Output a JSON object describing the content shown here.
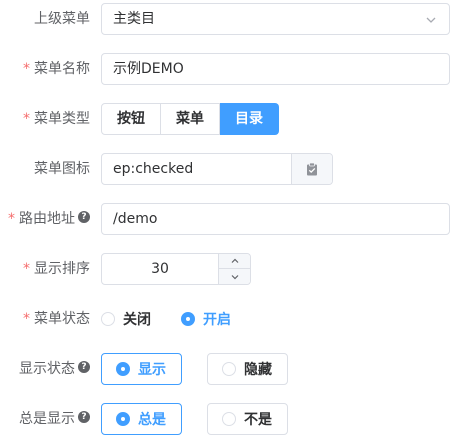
{
  "form": {
    "parent_menu": {
      "label": "上级菜单",
      "value": "主类目"
    },
    "menu_name": {
      "label": "菜单名称",
      "value": "示例DEMO",
      "required": "*"
    },
    "menu_type": {
      "label": "菜单类型",
      "required": "*",
      "options": [
        "按钮",
        "菜单",
        "目录"
      ],
      "selected": "目录"
    },
    "menu_icon": {
      "label": "菜单图标",
      "value": "ep:checked",
      "icon": "clipboard-check-icon"
    },
    "route_path": {
      "label": "路由地址",
      "required": "*",
      "help": "?",
      "value": "/demo"
    },
    "sort_order": {
      "label": "显示排序",
      "required": "*",
      "value": "30"
    },
    "menu_status": {
      "label": "菜单状态",
      "required": "*",
      "options": [
        "关闭",
        "开启"
      ],
      "selected": "开启"
    },
    "display_status": {
      "label": "显示状态",
      "help": "?",
      "options": [
        "显示",
        "隐藏"
      ],
      "selected": "显示"
    },
    "always_show": {
      "label": "总是显示",
      "help": "?",
      "options": [
        "总是",
        "不是"
      ],
      "selected": "总是"
    }
  },
  "colors": {
    "primary": "#409eff",
    "required": "#f56c6c",
    "border": "#dcdfe6"
  }
}
